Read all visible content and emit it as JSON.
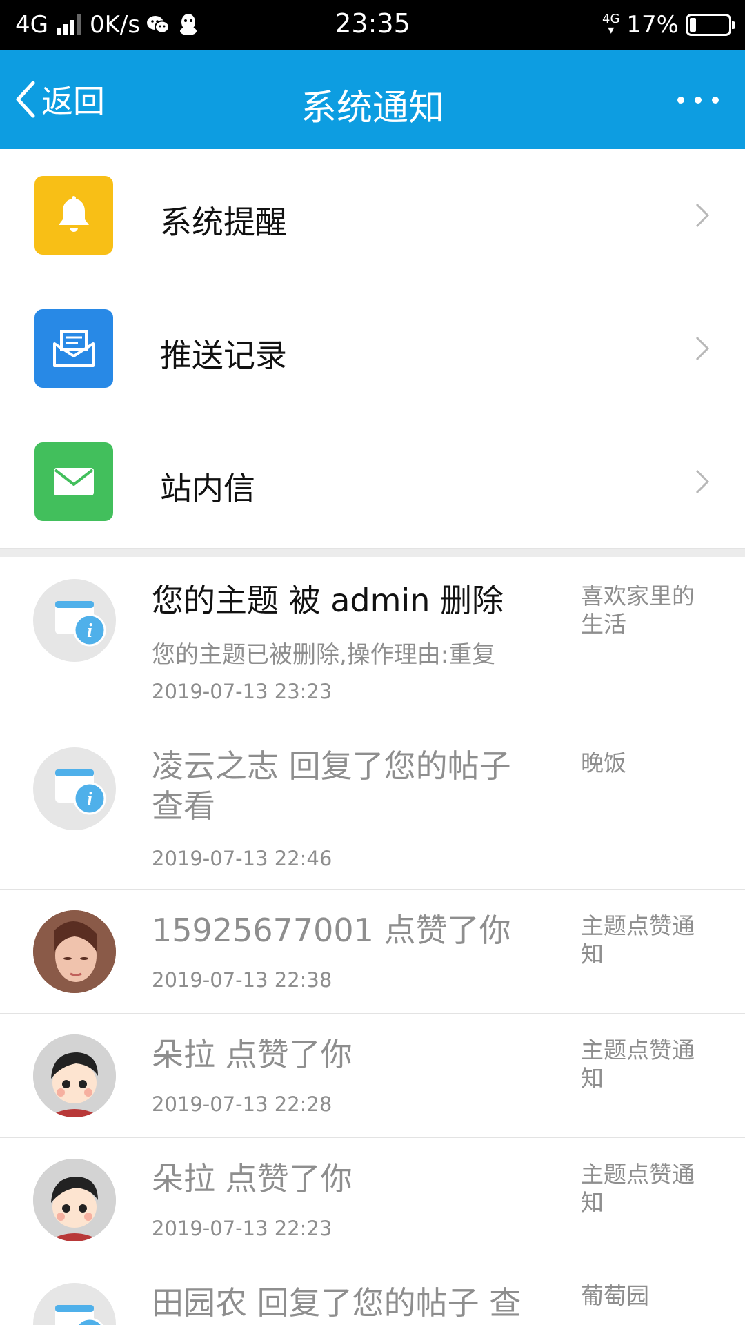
{
  "status_bar": {
    "network": "4G",
    "speed": "0K/s",
    "time": "23:35",
    "network_right": "4G",
    "battery": "17%",
    "battery_level": 0.17,
    "icons": [
      "signal-icon",
      "wechat-icon",
      "qq-icon",
      "battery-icon"
    ]
  },
  "header": {
    "back_label": "返回",
    "title": "系统通知",
    "more_icon": "more-dots-icon",
    "bg_color": "#0d9de1"
  },
  "categories": [
    {
      "label": "系统提醒",
      "icon": "bell-icon",
      "color": "#f8bf16"
    },
    {
      "label": "推送记录",
      "icon": "mail-open-icon",
      "color": "#2889e6"
    },
    {
      "label": "站内信",
      "icon": "envelope-icon",
      "color": "#42bf5c"
    }
  ],
  "messages": [
    {
      "title": "您的主题 被 admin 删除",
      "preview": "您的主题已被删除,操作理由:重复",
      "time": "2019-07-13 23:23",
      "source": "喜欢家里的生活",
      "avatar": "system-info-icon",
      "read": false
    },
    {
      "title": "凌云之志 回复了您的帖子 查看",
      "time": "2019-07-13 22:46",
      "source": "晚饭",
      "avatar": "system-info-icon",
      "read": true
    },
    {
      "title": "15925677001 点赞了你",
      "time": "2019-07-13 22:38",
      "source": "主题点赞通知",
      "avatar": "user-photo-avatar",
      "read": true
    },
    {
      "title": "朵拉 点赞了你",
      "time": "2019-07-13 22:28",
      "source": "主题点赞通知",
      "avatar": "cartoon-avatar",
      "read": true
    },
    {
      "title": "朵拉 点赞了你",
      "time": "2019-07-13 22:23",
      "source": "主题点赞通知",
      "avatar": "cartoon-avatar",
      "read": true
    },
    {
      "title": "田园农 回复了您的帖子  查",
      "source": "葡萄园",
      "avatar": "system-info-icon",
      "read": true
    }
  ]
}
